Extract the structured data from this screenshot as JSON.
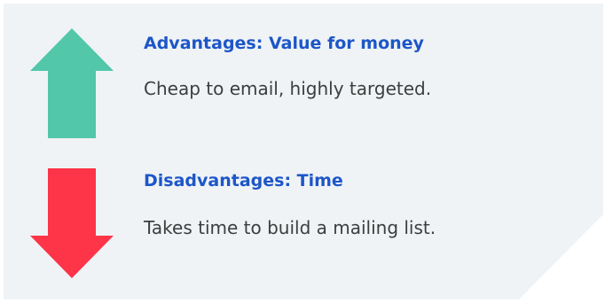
{
  "colors": {
    "panel_background": "#eff3f6",
    "heading_text": "#1d56c8",
    "body_text": "#3d3d3d",
    "advantage_arrow": "#52c7a9",
    "disadvantage_arrow": "#fe3448"
  },
  "advantages": {
    "icon": "arrow-up-icon",
    "heading": "Advantages: Value for money",
    "description": "Cheap to email, highly targeted."
  },
  "disadvantages": {
    "icon": "arrow-down-icon",
    "heading": "Disadvantages: Time",
    "description": "Takes time to build a mailing list."
  }
}
